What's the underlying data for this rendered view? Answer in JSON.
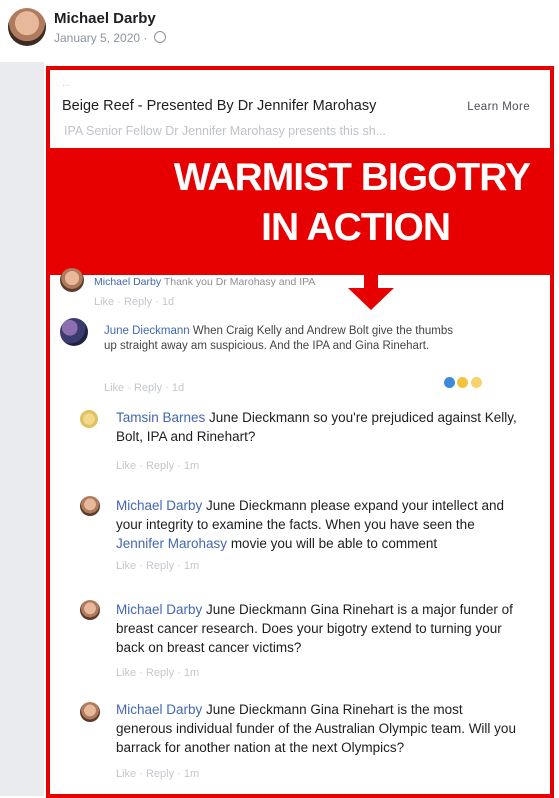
{
  "post": {
    "author": "Michael Darby",
    "date": "January 5, 2020",
    "date_sep": "·"
  },
  "link_card": {
    "faint_line": "...",
    "title": "Beige Reef - Presented By Dr Jennifer Marohasy",
    "learn_more": "Learn More",
    "description": "IPA Senior Fellow Dr Jennifer Marohasy presents this sh..."
  },
  "banner": {
    "line1": "WARMIST BIGOTRY",
    "line2": "IN ACTION",
    "color": "#e60000"
  },
  "comments": [
    {
      "name": "Michael Darby",
      "text": " Thank you Dr Marohasy and IPA",
      "actions": "Like · Reply · 1d"
    },
    {
      "name": "June Dieckmann",
      "text": " When Craig Kelly and Andrew Bolt give the thumbs up straight away am suspicious. And the IPA and Gina Rinehart.",
      "actions": "Like · Reply · 1d"
    },
    {
      "name": "Tamsin Barnes",
      "text": " June Dieckmann so you're prejudiced against Kelly, Bolt, IPA and Rinehart?",
      "actions": "Like · Reply · 1m"
    },
    {
      "name": "Michael Darby",
      "text_a": " June Dieckmann please expand your intellect and your integrity to examine the facts. When you have seen the ",
      "mention": "Jennifer Marohasy",
      "text_b": " movie you will be able to comment",
      "actions": "Like · Reply · 1m"
    },
    {
      "name": "Michael Darby",
      "text": " June Dieckmann Gina Rinehart is a major funder of breast cancer research. Does your bigotry extend to turning your back on breast cancer victims?",
      "actions": "Like · Reply · 1m"
    },
    {
      "name": "Michael Darby",
      "text": " June Dieckmann Gina Rinehart is the most generous individual funder of the Australian Olympic team. Will you barrack for another nation at the next Olympics?",
      "actions": "Like · Reply · 1m"
    }
  ],
  "icons": {
    "privacy": "globe-icon",
    "reactions": [
      "like-icon",
      "haha-icon",
      "sad-icon"
    ]
  }
}
